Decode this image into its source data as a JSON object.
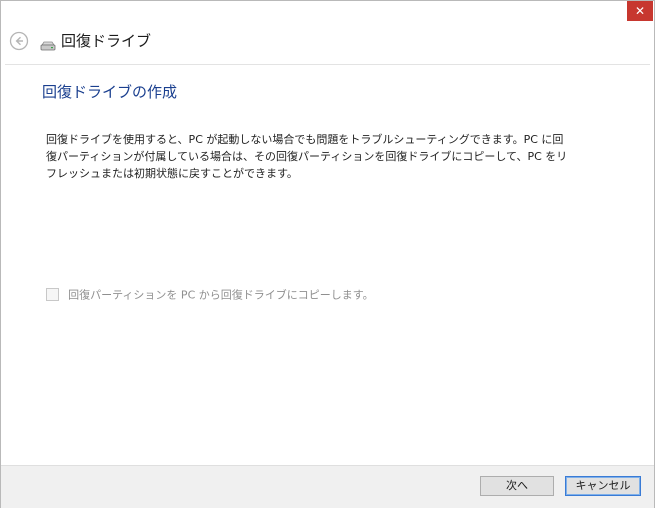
{
  "window": {
    "close_glyph": "✕"
  },
  "header": {
    "title": "回復ドライブ",
    "back_icon": "back-arrow-icon",
    "drive_icon": "drive-icon"
  },
  "main": {
    "heading": "回復ドライブの作成",
    "description": "回復ドライブを使用すると、PC が起動しない場合でも問題をトラブルシューティングできます。PC に回復パーティションが付属している場合は、その回復パーティションを回復ドライブにコピーして、PC をリフレッシュまたは初期状態に戻すことができます。",
    "checkbox_label": "回復パーティションを PC から回復ドライブにコピーします。",
    "checkbox_checked": false,
    "checkbox_enabled": false
  },
  "footer": {
    "next_label": "次へ",
    "cancel_label": "キャンセル"
  },
  "colors": {
    "heading": "#1a3f8f",
    "close_button": "#c7372f",
    "footer_bg": "#f0f0f0",
    "disabled_text": "#8f8f8f"
  }
}
